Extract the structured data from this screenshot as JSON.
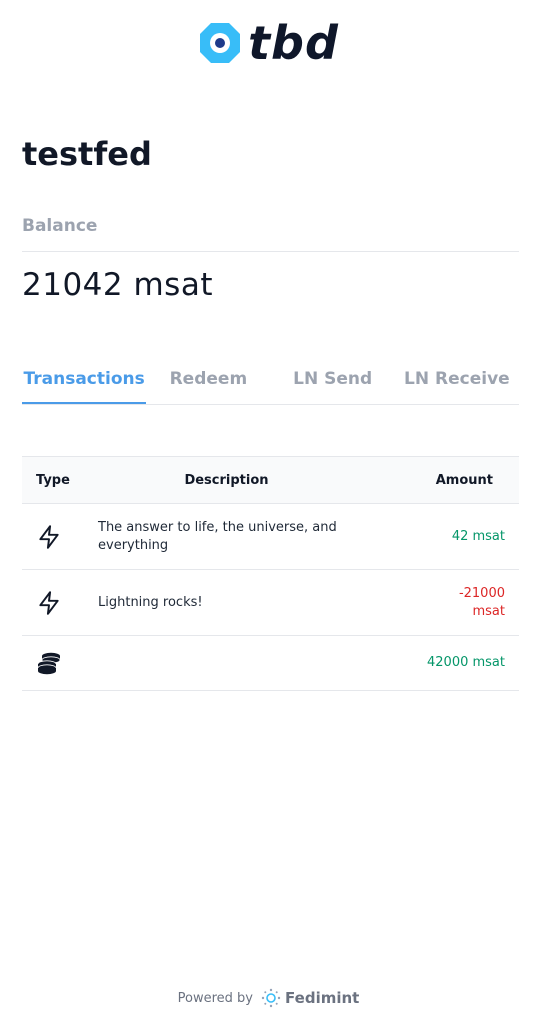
{
  "brand": {
    "logo_text": "tbd",
    "logo_mark_color": "#38bdf8"
  },
  "federation": {
    "name": "testfed"
  },
  "balance": {
    "label": "Balance",
    "value": "21042 msat"
  },
  "tabs": [
    {
      "label": "Transactions",
      "active": true
    },
    {
      "label": "Redeem",
      "active": false
    },
    {
      "label": "LN Send",
      "active": false
    },
    {
      "label": "LN Receive",
      "active": false
    }
  ],
  "table": {
    "headers": {
      "type": "Type",
      "description": "Description",
      "amount": "Amount"
    },
    "rows": [
      {
        "type_icon": "lightning-icon",
        "description": "The answer to life, the universe, and everything",
        "amount": "42 msat",
        "direction": "positive"
      },
      {
        "type_icon": "lightning-icon",
        "description": "Lightning rocks!",
        "amount": "-21000 msat",
        "direction": "negative"
      },
      {
        "type_icon": "coins-icon",
        "description": "",
        "amount": "42000 msat",
        "direction": "positive"
      }
    ]
  },
  "footer": {
    "powered_by": "Powered by",
    "brand": "Fedimint"
  },
  "colors": {
    "accent": "#4a9be8",
    "positive": "#059669",
    "negative": "#dc2626"
  }
}
